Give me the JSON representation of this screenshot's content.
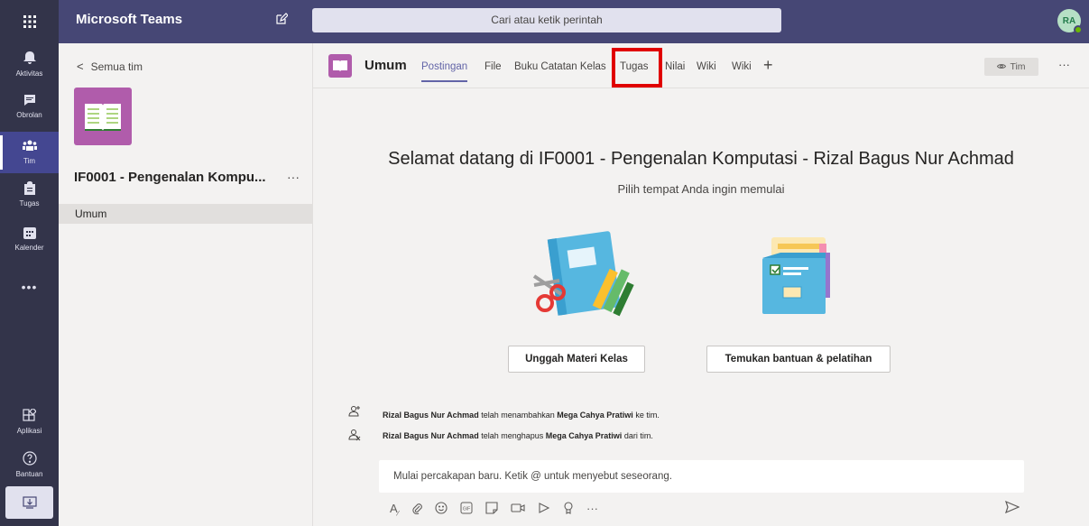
{
  "topbar": {
    "app_title": "Microsoft Teams",
    "search_placeholder": "Cari atau ketik perintah",
    "avatar_initials": "RA"
  },
  "rail": {
    "items": [
      {
        "label": "Aktivitas",
        "icon": "bell-icon"
      },
      {
        "label": "Obrolan",
        "icon": "chat-icon"
      },
      {
        "label": "Tim",
        "icon": "teams-icon"
      },
      {
        "label": "Tugas",
        "icon": "assignments-icon"
      },
      {
        "label": "Kalender",
        "icon": "calendar-icon"
      }
    ],
    "more": "•••",
    "apps_label": "Aplikasi",
    "help_label": "Bantuan"
  },
  "panel": {
    "back_label": "Semua tim",
    "team_name": "IF0001 - Pengenalan Kompu...",
    "more": "···",
    "channel": "Umum"
  },
  "header": {
    "channel_name": "Umum",
    "tabs": [
      "Postingan",
      "File",
      "Buku Catatan Kelas",
      "Tugas",
      "Nilai",
      "Wiki",
      "Wiki"
    ],
    "add_tab": "+",
    "team_button": "Tim",
    "more": "···"
  },
  "welcome": {
    "title": "Selamat datang di IF0001 - Pengenalan Komputasi - Rizal Bagus Nur Achmad",
    "subtitle": "Pilih tempat Anda ingin memulai",
    "upload_button": "Unggah Materi Kelas",
    "help_button": "Temukan bantuan & pelatihan"
  },
  "activity": [
    {
      "actor": "Rizal Bagus Nur Achmad",
      "action": "telah menambahkan",
      "target": "Mega Cahya Pratiwi",
      "suffix": "ke tim."
    },
    {
      "actor": "Rizal Bagus Nur Achmad",
      "action": "telah menghapus",
      "target": "Mega Cahya Pratiwi",
      "suffix": "dari tim."
    }
  ],
  "compose": {
    "placeholder": "Mulai percakapan baru. Ketik @ untuk menyebut seseorang.",
    "more": "···"
  },
  "colors": {
    "topbar": "#464775",
    "rail": "#33344a",
    "accent": "#6264a7",
    "team_tile": "#b05cab",
    "highlight": "#e00000"
  }
}
